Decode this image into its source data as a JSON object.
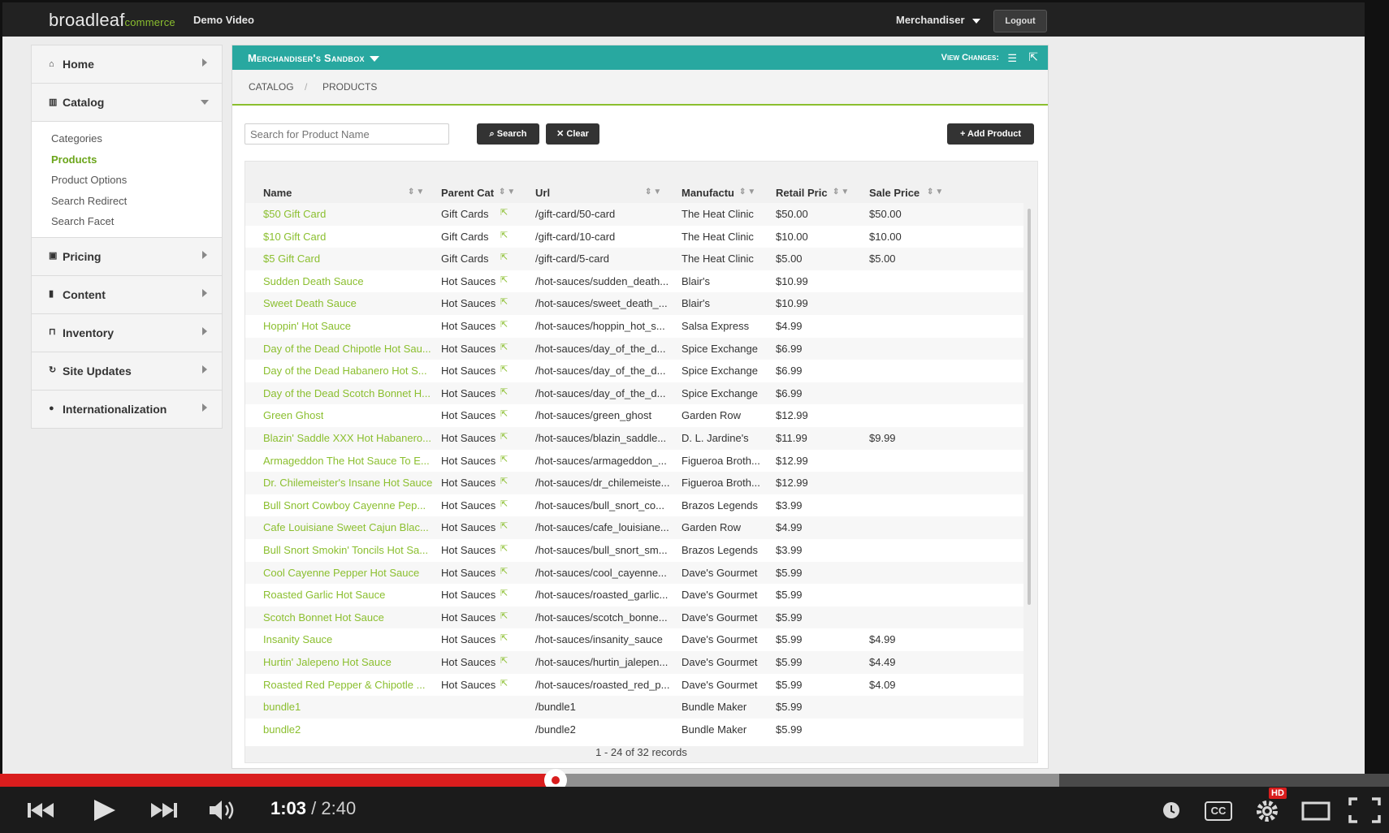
{
  "app": {
    "logo_main": "broadleaf",
    "logo_sub": "commerce",
    "video_title": "Demo Video",
    "user_menu": "Merchandiser",
    "logout": "Logout"
  },
  "sidebar": {
    "items": [
      {
        "label": "Home",
        "icon": "home-icon"
      },
      {
        "label": "Catalog",
        "icon": "catalog-icon"
      },
      {
        "label": "Pricing",
        "icon": "pricing-icon"
      },
      {
        "label": "Content",
        "icon": "file-icon"
      },
      {
        "label": "Inventory",
        "icon": "inventory-icon"
      },
      {
        "label": "Site Updates",
        "icon": "refresh-icon"
      },
      {
        "label": "Internationalization",
        "icon": "globe-icon"
      }
    ],
    "catalog_sub": [
      "Categories",
      "Products",
      "Product Options",
      "Search Redirect",
      "Search Facet"
    ],
    "active_sub": "Products"
  },
  "sandbox": {
    "title": "Merchandiser's Sandbox",
    "view_changes": "View Changes:"
  },
  "breadcrumb": [
    "CATALOG",
    "/",
    "PRODUCTS"
  ],
  "toolbar": {
    "search_placeholder": "Search for Product Name",
    "search_label": "Search",
    "clear_label": "Clear",
    "add_label": "Add Product"
  },
  "table": {
    "headers": [
      "Name",
      "Parent Cat",
      "Url",
      "Manufactu",
      "Retail Pric",
      "Sale Price"
    ],
    "rows": [
      [
        "$50 Gift Card",
        "Gift Cards",
        "/gift-card/50-card",
        "The Heat Clinic",
        "$50.00",
        "$50.00"
      ],
      [
        "$10 Gift Card",
        "Gift Cards",
        "/gift-card/10-card",
        "The Heat Clinic",
        "$10.00",
        "$10.00"
      ],
      [
        "$5 Gift Card",
        "Gift Cards",
        "/gift-card/5-card",
        "The Heat Clinic",
        "$5.00",
        "$5.00"
      ],
      [
        "Sudden Death Sauce",
        "Hot Sauces",
        "/hot-sauces/sudden_death...",
        "Blair's",
        "$10.99",
        ""
      ],
      [
        "Sweet Death Sauce",
        "Hot Sauces",
        "/hot-sauces/sweet_death_...",
        "Blair's",
        "$10.99",
        ""
      ],
      [
        "Hoppin' Hot Sauce",
        "Hot Sauces",
        "/hot-sauces/hoppin_hot_s...",
        "Salsa Express",
        "$4.99",
        ""
      ],
      [
        "Day of the Dead Chipotle Hot Sau...",
        "Hot Sauces",
        "/hot-sauces/day_of_the_d...",
        "Spice Exchange",
        "$6.99",
        ""
      ],
      [
        "Day of the Dead Habanero Hot S...",
        "Hot Sauces",
        "/hot-sauces/day_of_the_d...",
        "Spice Exchange",
        "$6.99",
        ""
      ],
      [
        "Day of the Dead Scotch Bonnet H...",
        "Hot Sauces",
        "/hot-sauces/day_of_the_d...",
        "Spice Exchange",
        "$6.99",
        ""
      ],
      [
        "Green Ghost",
        "Hot Sauces",
        "/hot-sauces/green_ghost",
        "Garden Row",
        "$12.99",
        ""
      ],
      [
        "Blazin' Saddle XXX Hot Habanero...",
        "Hot Sauces",
        "/hot-sauces/blazin_saddle...",
        "D. L. Jardine's",
        "$11.99",
        "$9.99"
      ],
      [
        "Armageddon The Hot Sauce To E...",
        "Hot Sauces",
        "/hot-sauces/armageddon_...",
        "Figueroa Broth...",
        "$12.99",
        ""
      ],
      [
        "Dr. Chilemeister's Insane Hot Sauce",
        "Hot Sauces",
        "/hot-sauces/dr_chilemeiste...",
        "Figueroa Broth...",
        "$12.99",
        ""
      ],
      [
        "Bull Snort Cowboy Cayenne Pep...",
        "Hot Sauces",
        "/hot-sauces/bull_snort_co...",
        "Brazos Legends",
        "$3.99",
        ""
      ],
      [
        "Cafe Louisiane Sweet Cajun Blac...",
        "Hot Sauces",
        "/hot-sauces/cafe_louisiane...",
        "Garden Row",
        "$4.99",
        ""
      ],
      [
        "Bull Snort Smokin' Toncils Hot Sa...",
        "Hot Sauces",
        "/hot-sauces/bull_snort_sm...",
        "Brazos Legends",
        "$3.99",
        ""
      ],
      [
        "Cool Cayenne Pepper Hot Sauce",
        "Hot Sauces",
        "/hot-sauces/cool_cayenne...",
        "Dave's Gourmet",
        "$5.99",
        ""
      ],
      [
        "Roasted Garlic Hot Sauce",
        "Hot Sauces",
        "/hot-sauces/roasted_garlic...",
        "Dave's Gourmet",
        "$5.99",
        ""
      ],
      [
        "Scotch Bonnet Hot Sauce",
        "Hot Sauces",
        "/hot-sauces/scotch_bonne...",
        "Dave's Gourmet",
        "$5.99",
        ""
      ],
      [
        "Insanity Sauce",
        "Hot Sauces",
        "/hot-sauces/insanity_sauce",
        "Dave's Gourmet",
        "$5.99",
        "$4.99"
      ],
      [
        "Hurtin' Jalepeno Hot Sauce",
        "Hot Sauces",
        "/hot-sauces/hurtin_jalepen...",
        "Dave's Gourmet",
        "$5.99",
        "$4.49"
      ],
      [
        "Roasted Red Pepper & Chipotle ...",
        "Hot Sauces",
        "/hot-sauces/roasted_red_p...",
        "Dave's Gourmet",
        "$5.99",
        "$4.09"
      ],
      [
        "bundle1",
        "",
        "/bundle1",
        "Bundle Maker",
        "$5.99",
        ""
      ],
      [
        "bundle2",
        "",
        "/bundle2",
        "Bundle Maker",
        "$5.99",
        ""
      ]
    ],
    "footer": "1 - 24 of 32 records"
  },
  "player": {
    "current_time": "1:03",
    "separator": " / ",
    "total_time": "2:40",
    "progress": 0.4,
    "hd_badge": "HD",
    "cc_label": "CC"
  },
  "colors": {
    "accent_green": "#8bbf2f",
    "sandbox_teal": "#28a8a0",
    "player_red": "#d91d1d"
  }
}
